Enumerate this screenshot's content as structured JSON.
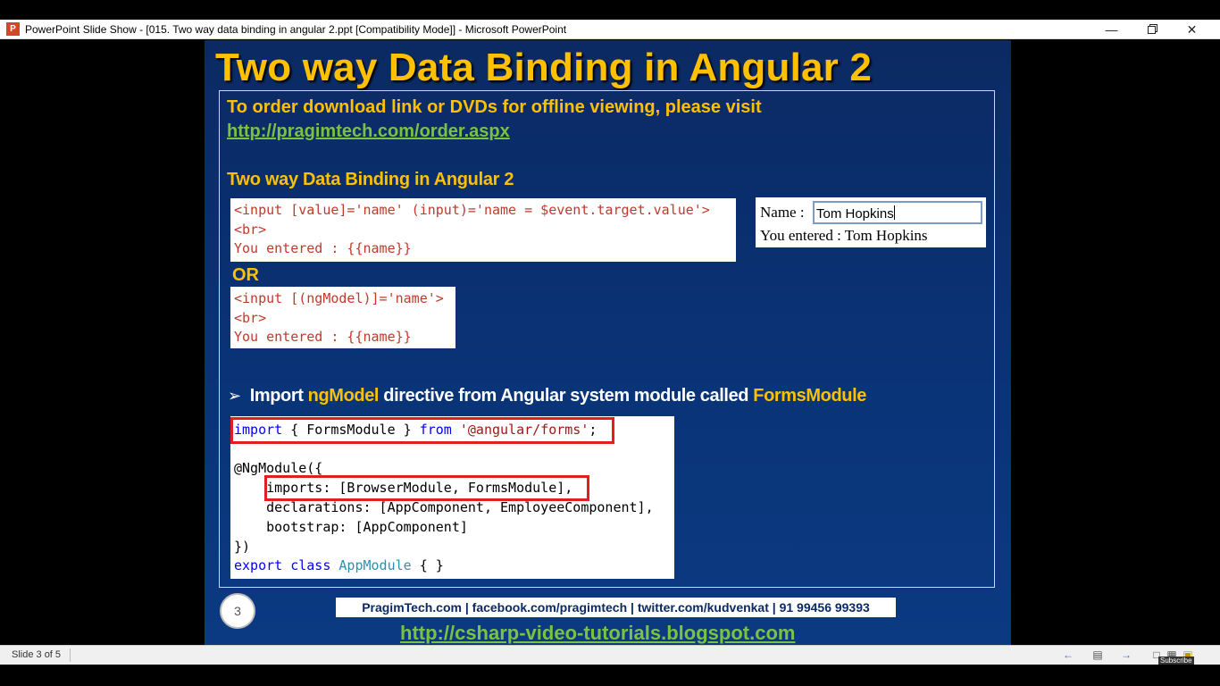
{
  "window": {
    "title": "PowerPoint Slide Show - [015. Two way data binding in angular 2.ppt [Compatibility Mode]] - Microsoft PowerPoint",
    "app_icon_letter": "P",
    "minimize_glyph": "—",
    "close_glyph": "✕"
  },
  "slide": {
    "title": "Two way Data Binding in Angular 2",
    "order_text": "To order download link or DVDs for offline viewing, please visit",
    "order_link": "http://pragimtech.com/order.aspx",
    "section_heading": "Two way Data Binding in Angular 2",
    "code1": [
      "<input [value]='name' (input)='name = $event.target.value'>",
      "<br>",
      "You entered : {{name}}"
    ],
    "or_label": "OR",
    "code2": [
      "<input [(ngModel)]='name'>",
      "<br>",
      "You entered : {{name}}"
    ],
    "demo": {
      "name_label": "Name :",
      "input_value": "Tom Hopkins",
      "entered_text": "You entered : Tom Hopkins"
    },
    "bullet": {
      "arrow": "➢",
      "part1": "Import ",
      "part2": "ngModel",
      "part3": " directive from Angular system module called ",
      "part4": "FormsModule"
    },
    "code3": {
      "l1_kw": "import",
      "l1_mid": " { FormsModule } ",
      "l1_from": "from",
      "l1_str": "'@angular/forms'",
      "l1_end": ";",
      "l3": "@NgModule({",
      "l4": "    imports: [BrowserModule, FormsModule],",
      "l5": "    declarations: [AppComponent, EmployeeComponent],",
      "l6": "    bootstrap: [AppComponent]",
      "l7": "})",
      "l8_kw1": "export",
      "l8_kw2": "class",
      "l8_cls": "AppModule",
      "l8_end": " { }"
    },
    "slide_number": "3",
    "footer_contacts": "PragimTech.com | facebook.com/pragimtech | twitter.com/kudvenkat | 91 99456 99393",
    "footer_link": "http://csharp-video-tutorials.blogspot.com"
  },
  "statusbar": {
    "slide_counter": "Slide 3 of 5",
    "subscribe_label": "Subscribe"
  },
  "colors": {
    "title_yellow": "#ffc000",
    "link_green": "#7cc242",
    "slide_bg": "#0a3377",
    "code_red": "#c0392b",
    "highlight_red": "#e02020"
  }
}
